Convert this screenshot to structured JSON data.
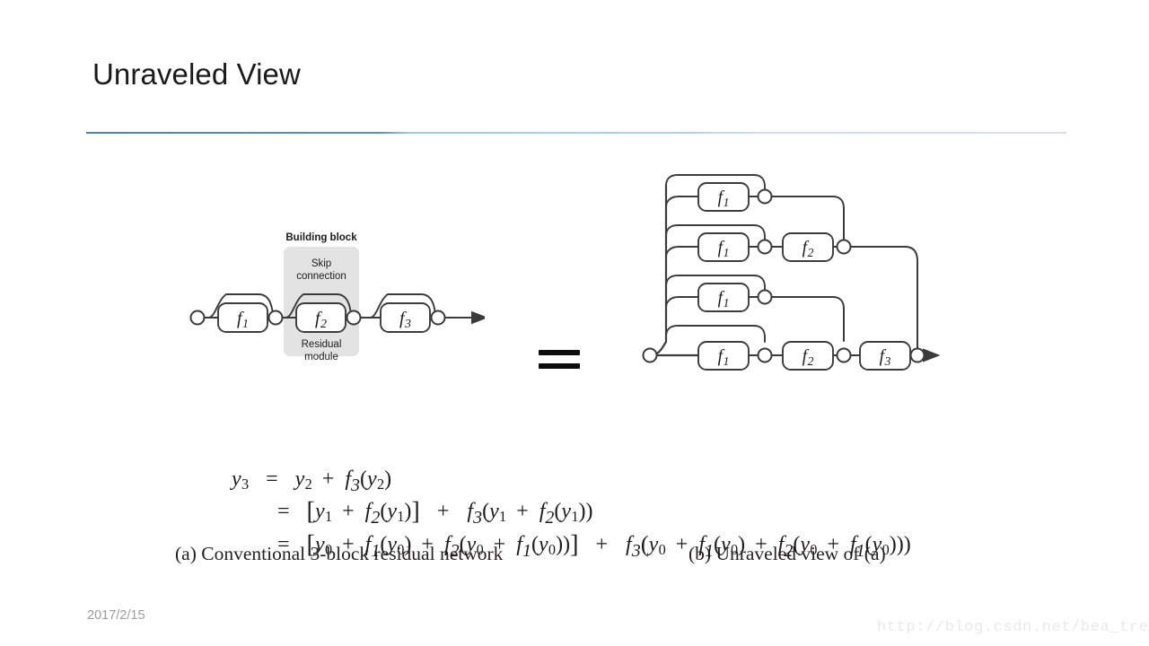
{
  "slide": {
    "title": "Unraveled View",
    "footer_date": "2017/2/15",
    "watermark": "http://blog.csdn.net/bea_tree",
    "accent_color": "#4f81bd",
    "rule_color_right": "#cfe1f2"
  },
  "figure": {
    "equals_symbol": "=",
    "panel_a": {
      "caption": "(a)  Conventional 3-block residual network",
      "annotations": {
        "building_block": "Building block",
        "skip_connection": "Skip\nconnection",
        "skip_connection_line1": "Skip",
        "skip_connection_line2": "connection",
        "residual_module_line1": "Residual",
        "residual_module_line2": "module"
      },
      "blocks": [
        {
          "label": "f",
          "subscript": "1"
        },
        {
          "label": "f",
          "subscript": "2"
        },
        {
          "label": "f",
          "subscript": "3"
        }
      ],
      "highlight_fill": "#e3e3e3"
    },
    "panel_b": {
      "caption": "(b)  Unraveled view of (a)",
      "rows": [
        {
          "blocks": [
            {
              "label": "f",
              "subscript": "1"
            }
          ]
        },
        {
          "blocks": [
            {
              "label": "f",
              "subscript": "1"
            },
            {
              "label": "f",
              "subscript": "2"
            }
          ]
        },
        {
          "blocks": [
            {
              "label": "f",
              "subscript": "1"
            }
          ]
        },
        {
          "blocks": [
            {
              "label": "f",
              "subscript": "1"
            },
            {
              "label": "f",
              "subscript": "2"
            },
            {
              "label": "f",
              "subscript": "3"
            }
          ]
        }
      ]
    },
    "stroke_color": "#3b3b3b"
  },
  "equations": {
    "line1": {
      "lhs": "y",
      "lhs_sub": "3",
      "eq": "=",
      "t1": "y",
      "t1_sub": "2",
      "plus": "+",
      "f": "f",
      "f_sub": "3",
      "arg": "y",
      "arg_sub": "2"
    },
    "line2": {
      "eq": "=",
      "t1": "y",
      "t1_sub": "1",
      "plus1": "+",
      "f2": "f",
      "f2_sub": "2",
      "f2arg": "y",
      "f2arg_sub": "1",
      "plus2": "+",
      "f3": "f",
      "f3_sub": "3",
      "i1": "y",
      "i1_sub": "1",
      "plus3": "+",
      "i2": "f",
      "i2_sub": "2",
      "i3": "y",
      "i3_sub": "1"
    },
    "line3": {
      "eq": "=",
      "t1": "y",
      "t1_sub": "0",
      "plus1": "+",
      "a1": "f",
      "a1_sub": "1",
      "a1arg": "y",
      "a1arg_sub": "0",
      "plus2": "+",
      "a2": "f",
      "a2_sub": "2",
      "a2arg": "y",
      "a2arg_sub": "0",
      "plus3": "+",
      "a3": "f",
      "a3_sub": "1",
      "a3arg": "y",
      "a3arg_sub": "0",
      "plus4": "+",
      "b0": "f",
      "b0_sub": "3",
      "b1": "y",
      "b1_sub": "0",
      "plus5": "+",
      "b2": "f",
      "b2_sub": "1",
      "b2arg": "y",
      "b2arg_sub": "0",
      "plus6": "+",
      "b3": "f",
      "b3_sub": "2",
      "b3arg": "y",
      "b3arg_sub": "0",
      "plus7": "+",
      "b4": "f",
      "b4_sub": "1",
      "b4arg": "y",
      "b4arg_sub": "0"
    }
  }
}
